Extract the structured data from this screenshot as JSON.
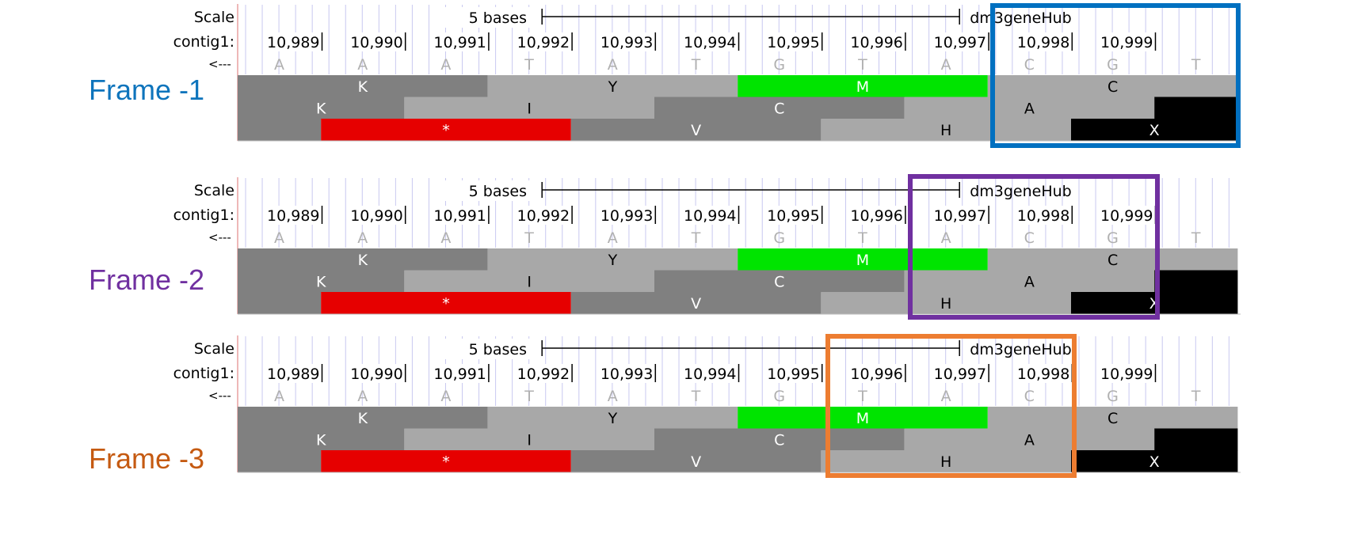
{
  "frames": [
    {
      "id": "f1",
      "label": "Frame -1",
      "label_color": "#0e74bc",
      "highlight_color": "#0070c0"
    },
    {
      "id": "f2",
      "label": "Frame -2",
      "label_color": "#7030a0",
      "highlight_color": "#7030a0"
    },
    {
      "id": "f3",
      "label": "Frame -3",
      "label_color": "#c55a11",
      "highlight_color": "#ed7d31"
    }
  ],
  "track": {
    "scale_label": "Scale",
    "chrom_label": "contig1:",
    "strand_label": "<---",
    "scale_text": "5 bases",
    "hub_label": "dm3geneHub",
    "positions": [
      "10,989",
      "10,990",
      "10,991",
      "10,992",
      "10,993",
      "10,994",
      "10,995",
      "10,996",
      "10,997",
      "10,998",
      "10,999"
    ],
    "bases": [
      "A",
      "A",
      "A",
      "T",
      "A",
      "T",
      "G",
      "T",
      "A",
      "C",
      "G",
      "T"
    ],
    "rows": [
      [
        {
          "start": 0,
          "end": 3,
          "aa": "K",
          "color": "#808080"
        },
        {
          "start": 3,
          "end": 6,
          "aa": "Y",
          "color": "#a8a8a8"
        },
        {
          "start": 6,
          "end": 9,
          "aa": "M",
          "color": "#00e400"
        },
        {
          "start": 9,
          "end": 12,
          "aa": "C",
          "color": "#a8a8a8"
        }
      ],
      [
        {
          "start": 0,
          "end": 2,
          "aa": "K",
          "color": "#808080"
        },
        {
          "start": 2,
          "end": 5,
          "aa": "I",
          "color": "#a8a8a8"
        },
        {
          "start": 5,
          "end": 8,
          "aa": "C",
          "color": "#808080"
        },
        {
          "start": 8,
          "end": 11,
          "aa": "A",
          "color": "#a8a8a8"
        },
        {
          "start": 11,
          "end": 12,
          "aa": "",
          "color": "#000000"
        }
      ],
      [
        {
          "start": 0,
          "end": 1,
          "aa": "",
          "color": "#808080"
        },
        {
          "start": 1,
          "end": 4,
          "aa": "*",
          "color": "#e60000"
        },
        {
          "start": 4,
          "end": 7,
          "aa": "V",
          "color": "#808080"
        },
        {
          "start": 7,
          "end": 10,
          "aa": "H",
          "color": "#a8a8a8"
        },
        {
          "start": 10,
          "end": 12,
          "aa": "X",
          "color": "#000000"
        }
      ]
    ]
  }
}
